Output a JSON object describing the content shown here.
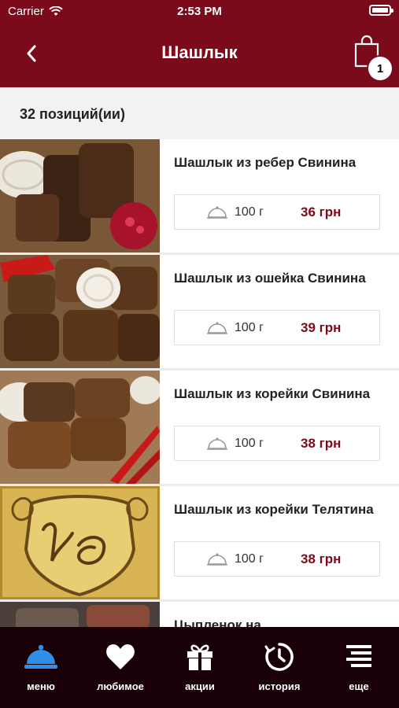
{
  "status": {
    "carrier": "Carrier",
    "time": "2:53 PM"
  },
  "header": {
    "title": "Шашлык",
    "cart_count": "1"
  },
  "count_text": "32 позиций(ии)",
  "items": [
    {
      "name": "Шашлык из ребер Свинина",
      "weight": "100 г",
      "price": "36 грн"
    },
    {
      "name": "Шашлык из ошейка Свинина",
      "weight": "100 г",
      "price": "39 грн"
    },
    {
      "name": "Шашлык из корейки Свинина",
      "weight": "100 г",
      "price": "38 грн"
    },
    {
      "name": "Шашлык из корейки Телятина",
      "weight": "100 г",
      "price": "38 грн"
    },
    {
      "name": "Цыпленок на",
      "weight": "",
      "price": ""
    }
  ],
  "tabs": [
    {
      "label": "меню",
      "icon": "cloche-icon",
      "active": true
    },
    {
      "label": "любимое",
      "icon": "heart-icon",
      "active": false
    },
    {
      "label": "акции",
      "icon": "gift-icon",
      "active": false
    },
    {
      "label": "история",
      "icon": "history-icon",
      "active": false
    },
    {
      "label": "еще",
      "icon": "menu-lines-icon",
      "active": false
    }
  ],
  "colors": {
    "brand": "#7b0a1a",
    "tabbar": "#180006",
    "active_tab": "#2f8ee8"
  }
}
